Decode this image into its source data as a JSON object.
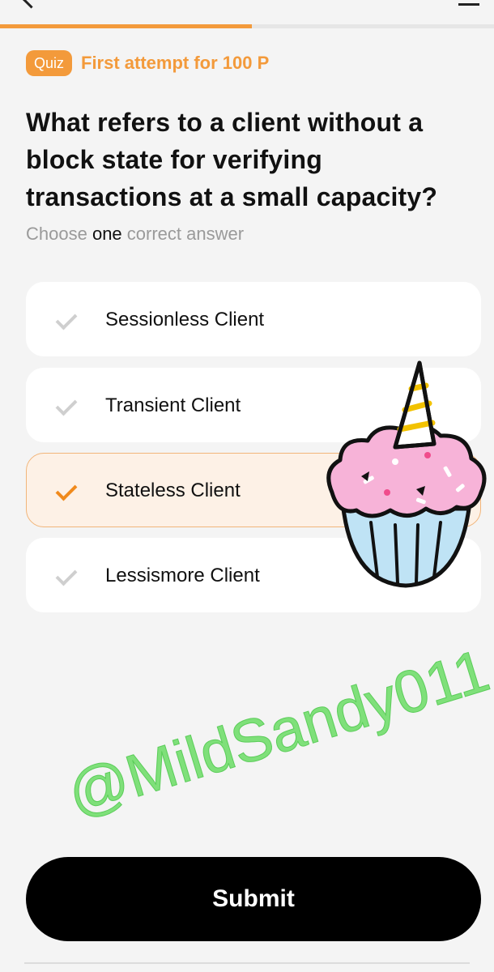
{
  "progress": {
    "fraction": 0.51
  },
  "badge": {
    "label": "Quiz"
  },
  "attempt": {
    "text": "First attempt for 100 P"
  },
  "question": {
    "text": "What refers to a client without a block state for verifying transactions at a small capacity?"
  },
  "instruction": {
    "prefix": "Choose ",
    "emphasis": "one",
    "suffix": " correct answer"
  },
  "options": [
    {
      "label": "Sessionless Client",
      "selected": false
    },
    {
      "label": "Transient Client",
      "selected": false
    },
    {
      "label": "Stateless Client",
      "selected": true
    },
    {
      "label": "Lessismore Client",
      "selected": false
    }
  ],
  "watermark": {
    "text": "@MildSandy011"
  },
  "submit": {
    "label": "Submit"
  },
  "colors": {
    "accent": "#f39a3b",
    "selected_bg": "#fdf1e6",
    "watermark": "#7fe07a",
    "button": "#000000"
  },
  "icons": {
    "back": "back-arrow-icon",
    "menu": "menu-icon",
    "check": "check-icon",
    "sticker": "unicorn-cupcake-sticker"
  }
}
